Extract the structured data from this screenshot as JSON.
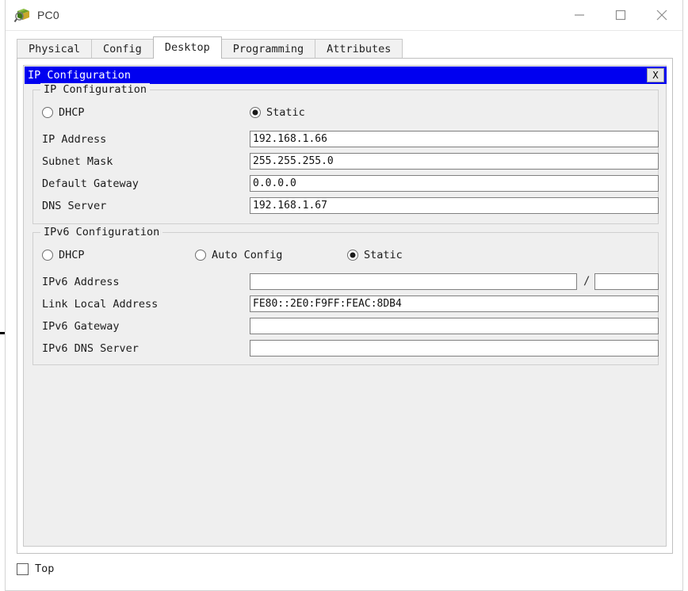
{
  "window": {
    "title": "PC0",
    "icon": "packet-tracer-device-icon",
    "controls": {
      "minimize": "minimize-icon",
      "maximize": "maximize-icon",
      "close": "close-icon"
    }
  },
  "tabs": [
    {
      "label": "Physical",
      "active": false
    },
    {
      "label": "Config",
      "active": false
    },
    {
      "label": "Desktop",
      "active": true
    },
    {
      "label": "Programming",
      "active": false
    },
    {
      "label": "Attributes",
      "active": false
    }
  ],
  "dialog": {
    "title": "IP Configuration",
    "close_label": "X",
    "title_bar_color": "#0000f0"
  },
  "ipv4": {
    "group_label": "IP Configuration",
    "mode_options": [
      {
        "label": "DHCP",
        "selected": false
      },
      {
        "label": "Static",
        "selected": true
      }
    ],
    "fields": [
      {
        "label": "IP Address",
        "value": "192.168.1.66",
        "placeholder": ""
      },
      {
        "label": "Subnet Mask",
        "value": "255.255.255.0",
        "placeholder": ""
      },
      {
        "label": "Default Gateway",
        "value": "0.0.0.0",
        "placeholder": ""
      },
      {
        "label": "DNS Server",
        "value": "192.168.1.67",
        "placeholder": ""
      }
    ]
  },
  "ipv6": {
    "group_label": "IPv6 Configuration",
    "mode_options": [
      {
        "label": "DHCP",
        "selected": false
      },
      {
        "label": "Auto Config",
        "selected": false
      },
      {
        "label": "Static",
        "selected": true
      }
    ],
    "address_row": {
      "label": "IPv6 Address",
      "value": "",
      "separator": "/",
      "prefix_value": ""
    },
    "fields": [
      {
        "label": "Link Local Address",
        "value": "FE80::2E0:F9FF:FEAC:8DB4",
        "placeholder": ""
      },
      {
        "label": "IPv6 Gateway",
        "value": "",
        "placeholder": ""
      },
      {
        "label": "IPv6 DNS Server",
        "value": "",
        "placeholder": ""
      }
    ]
  },
  "bottom": {
    "top_checkbox_label": "Top",
    "top_checkbox_checked": false
  }
}
